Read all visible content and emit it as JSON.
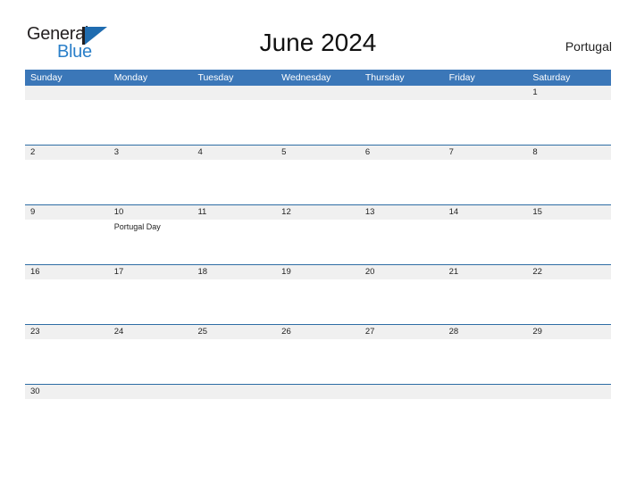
{
  "brand": {
    "name_part1": "General",
    "name_part2": "Blue",
    "flag_icon": "triangle-flag-icon",
    "accent_color": "#1f6cb0",
    "secondary_color": "#2a7fc9"
  },
  "header": {
    "title": "June 2024",
    "country": "Portugal"
  },
  "calendar": {
    "header_bg_color": "#3b77b8",
    "date_band_color": "#f0f0f0",
    "row_line_color": "#2e6da4",
    "weekdays": [
      "Sunday",
      "Monday",
      "Tuesday",
      "Wednesday",
      "Thursday",
      "Friday",
      "Saturday"
    ],
    "weeks": [
      {
        "days": [
          {
            "date": "",
            "events": []
          },
          {
            "date": "",
            "events": []
          },
          {
            "date": "",
            "events": []
          },
          {
            "date": "",
            "events": []
          },
          {
            "date": "",
            "events": []
          },
          {
            "date": "",
            "events": []
          },
          {
            "date": "1",
            "events": []
          }
        ]
      },
      {
        "days": [
          {
            "date": "2",
            "events": []
          },
          {
            "date": "3",
            "events": []
          },
          {
            "date": "4",
            "events": []
          },
          {
            "date": "5",
            "events": []
          },
          {
            "date": "6",
            "events": []
          },
          {
            "date": "7",
            "events": []
          },
          {
            "date": "8",
            "events": []
          }
        ]
      },
      {
        "days": [
          {
            "date": "9",
            "events": []
          },
          {
            "date": "10",
            "events": [
              "Portugal Day"
            ]
          },
          {
            "date": "11",
            "events": []
          },
          {
            "date": "12",
            "events": []
          },
          {
            "date": "13",
            "events": []
          },
          {
            "date": "14",
            "events": []
          },
          {
            "date": "15",
            "events": []
          }
        ]
      },
      {
        "days": [
          {
            "date": "16",
            "events": []
          },
          {
            "date": "17",
            "events": []
          },
          {
            "date": "18",
            "events": []
          },
          {
            "date": "19",
            "events": []
          },
          {
            "date": "20",
            "events": []
          },
          {
            "date": "21",
            "events": []
          },
          {
            "date": "22",
            "events": []
          }
        ]
      },
      {
        "days": [
          {
            "date": "23",
            "events": []
          },
          {
            "date": "24",
            "events": []
          },
          {
            "date": "25",
            "events": []
          },
          {
            "date": "26",
            "events": []
          },
          {
            "date": "27",
            "events": []
          },
          {
            "date": "28",
            "events": []
          },
          {
            "date": "29",
            "events": []
          }
        ]
      },
      {
        "days": [
          {
            "date": "30",
            "events": []
          },
          {
            "date": "",
            "events": []
          },
          {
            "date": "",
            "events": []
          },
          {
            "date": "",
            "events": []
          },
          {
            "date": "",
            "events": []
          },
          {
            "date": "",
            "events": []
          },
          {
            "date": "",
            "events": []
          }
        ]
      }
    ]
  }
}
